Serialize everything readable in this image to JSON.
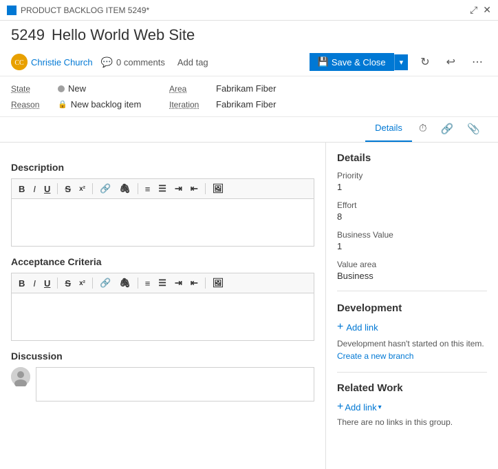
{
  "titleBar": {
    "icon": "■",
    "label": "PRODUCT BACKLOG ITEM 5249*",
    "expandIcon": "⤢",
    "closeIcon": "✕"
  },
  "header": {
    "id": "5249",
    "name": "Hello World Web Site"
  },
  "user": {
    "name": "Christie Church",
    "initials": "CC"
  },
  "comments": {
    "label": "0 comments"
  },
  "addTag": {
    "label": "Add tag"
  },
  "saveClose": {
    "label": "Save & Close"
  },
  "state": {
    "label": "State",
    "value": "New"
  },
  "reason": {
    "label": "Reason",
    "value": "New backlog item"
  },
  "area": {
    "label": "Area",
    "value": "Fabrikam Fiber"
  },
  "iteration": {
    "label": "Iteration",
    "value": "Fabrikam Fiber"
  },
  "tabs": [
    {
      "label": "Details",
      "active": true
    },
    {
      "label": "history-icon",
      "icon": "⏱"
    },
    {
      "label": "link-icon",
      "icon": "🔗"
    },
    {
      "label": "attachment-icon",
      "icon": "📎"
    }
  ],
  "description": {
    "sectionTitle": "Description"
  },
  "acceptanceCriteria": {
    "sectionTitle": "Acceptance Criteria"
  },
  "discussion": {
    "sectionTitle": "Discussion"
  },
  "rightPanel": {
    "title": "Details",
    "priority": {
      "label": "Priority",
      "value": "1"
    },
    "effort": {
      "label": "Effort",
      "value": "8"
    },
    "businessValue": {
      "label": "Business Value",
      "value": "1"
    },
    "valueArea": {
      "label": "Value area",
      "value": "Business"
    }
  },
  "development": {
    "title": "Development",
    "addLinkLabel": "Add link",
    "desc": "Development hasn't started on this item.",
    "createBranchLabel": "Create a new branch"
  },
  "relatedWork": {
    "title": "Related Work",
    "addLinkLabel": "Add link",
    "noLinksText": "There are no links in this group."
  },
  "toolbar": {
    "bold": "B",
    "italic": "I",
    "underline": "U",
    "strikethrough": "S",
    "superscript": "x²",
    "link1": "🔗",
    "link2": "🖇",
    "ul": "≡",
    "ol": "≡",
    "indent": "⇥",
    "outdent": "⇤",
    "image": "🖼"
  }
}
